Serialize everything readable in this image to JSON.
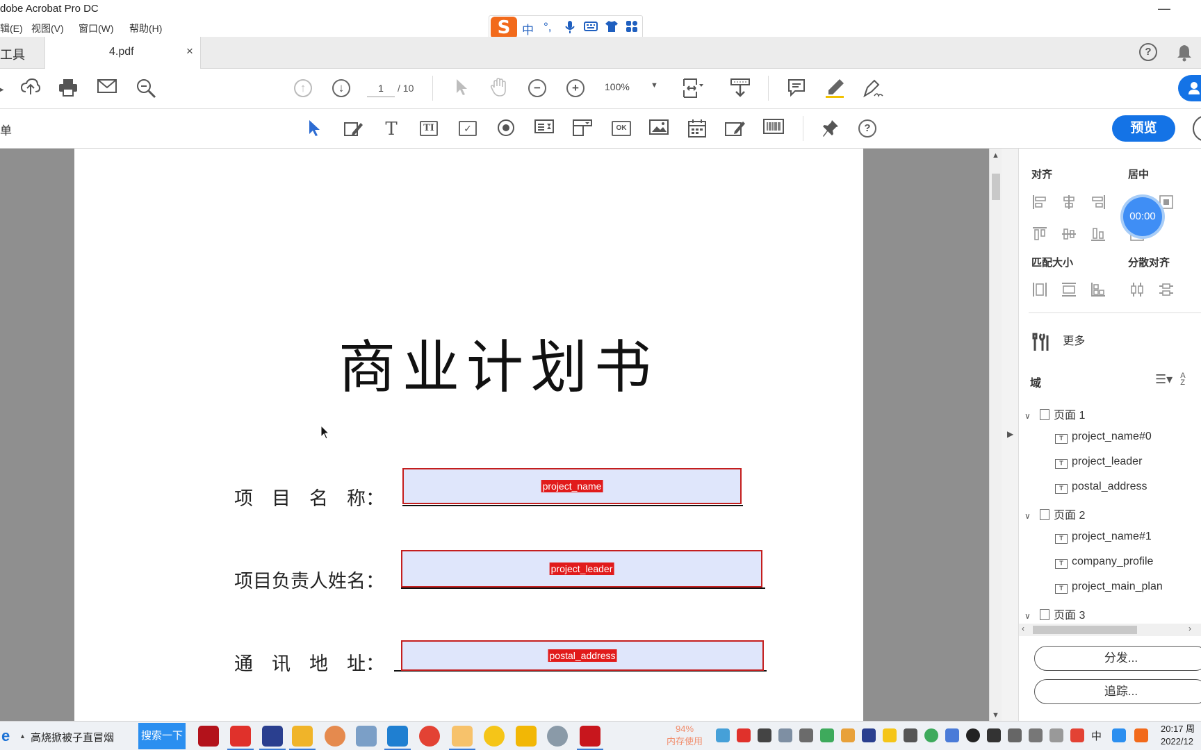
{
  "window": {
    "title": "dobe Acrobat Pro DC",
    "minimize_glyph": "—"
  },
  "menu": [
    "辑(E)",
    "视图(V)",
    "窗口(W)",
    "帮助(H)"
  ],
  "ime": {
    "logo": "S",
    "items": [
      "中",
      "°,",
      "mic-icon",
      "keyboard-icon",
      "shirt-icon",
      "apps-icon"
    ],
    "mode_label": "中",
    "punct_label": "°,"
  },
  "tabs": {
    "tools_label": "工具",
    "document_tab": "4.pdf",
    "close_glyph": "×"
  },
  "toolbar": {
    "current_page": "1",
    "total_pages": "/ 10",
    "zoom": "100%"
  },
  "form_toolbar": {
    "left_label": "单",
    "preview_label": "预览"
  },
  "document": {
    "title": "商业计划书",
    "rows": [
      {
        "label": "项　目　名　称：",
        "field": "project_name"
      },
      {
        "label": "项目负责人姓名：",
        "field": "project_leader"
      },
      {
        "label": "通　讯　地　址：",
        "field": "postal_address"
      }
    ]
  },
  "right_panel": {
    "align_heading": "对齐",
    "center_heading": "居中",
    "match_size_heading": "匹配大小",
    "distribute_heading": "分散对齐",
    "timer": "00:00",
    "more_label": "更多",
    "fields_heading": "域",
    "sort_label": "A Z",
    "tree": [
      {
        "page": "页面 1",
        "fields": [
          "project_name#0",
          "project_leader",
          "postal_address"
        ]
      },
      {
        "page": "页面 2",
        "fields": [
          "project_name#1",
          "company_profile",
          "project_main_plan"
        ]
      },
      {
        "page": "页面 3",
        "fields": []
      }
    ],
    "distribute_button": "分发...",
    "track_button": "追踪..."
  },
  "taskbar": {
    "search_text": "高烧掀被子直冒烟",
    "search_button": "搜索一下",
    "memory_percent": "94%",
    "memory_label": "内存使用",
    "ime_tray": "中",
    "time": "20:17 周",
    "date": "2022/12"
  },
  "colors": {
    "accent": "#1473e6",
    "field_border": "#c41e1e",
    "field_fill": "#dfe6fb",
    "field_tag": "#e11b1b",
    "doc_background": "#8f8f8f"
  }
}
